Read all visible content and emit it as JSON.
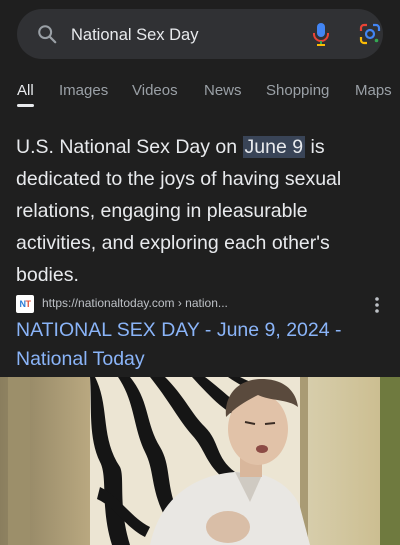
{
  "search": {
    "query": "National Sex Day",
    "search_icon": "search-icon",
    "mic_icon": "microphone-icon",
    "lens_icon": "google-lens-icon"
  },
  "tabs": [
    {
      "label": "All",
      "active": true
    },
    {
      "label": "Images",
      "active": false
    },
    {
      "label": "Videos",
      "active": false
    },
    {
      "label": "News",
      "active": false
    },
    {
      "label": "Shopping",
      "active": false
    },
    {
      "label": "Maps",
      "active": false
    }
  ],
  "answer": {
    "before": "U.S. National Sex Day on ",
    "highlight": "June 9",
    "after": " is dedicated to the joys of having sexual relations, engaging in pleasurable activities, and exploring each other's bodies."
  },
  "result": {
    "favicon_text_1": "N",
    "favicon_text_2": "T",
    "url": "https://nationaltoday.com › nation...",
    "title": "NATIONAL SEX DAY - June 9, 2024 - National Today",
    "menu_icon": "more-vert-icon"
  },
  "colors": {
    "background": "#1f1f1f",
    "search_bar": "#303134",
    "link": "#8ab4f8",
    "highlight": "#394457"
  },
  "image": {
    "subject": "man-in-white-shirt-zebra-print-backdrop"
  }
}
